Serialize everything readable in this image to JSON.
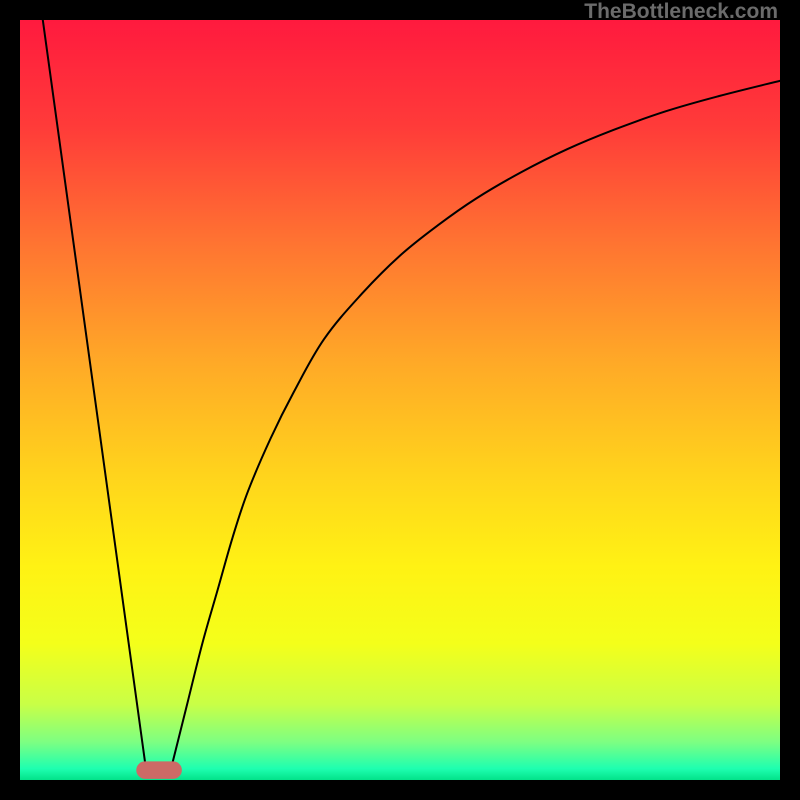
{
  "watermark": "TheBottleneck.com",
  "chart_data": {
    "type": "line",
    "title": "",
    "xlabel": "",
    "ylabel": "",
    "xlim": [
      0,
      100
    ],
    "ylim": [
      0,
      100
    ],
    "grid": false,
    "legend": false,
    "background": {
      "type": "vertical-gradient",
      "stops": [
        {
          "pos": 0.0,
          "color": "#ff1a3e"
        },
        {
          "pos": 0.14,
          "color": "#ff3b39"
        },
        {
          "pos": 0.3,
          "color": "#ff7631"
        },
        {
          "pos": 0.45,
          "color": "#ffa927"
        },
        {
          "pos": 0.6,
          "color": "#ffd41c"
        },
        {
          "pos": 0.72,
          "color": "#fff214"
        },
        {
          "pos": 0.82,
          "color": "#f4ff1a"
        },
        {
          "pos": 0.9,
          "color": "#c9ff46"
        },
        {
          "pos": 0.95,
          "color": "#7dff82"
        },
        {
          "pos": 0.985,
          "color": "#1effb0"
        },
        {
          "pos": 1.0,
          "color": "#02e289"
        }
      ]
    },
    "series": [
      {
        "name": "left-branch",
        "description": "steep descending line from top-left toward minimum",
        "x": [
          3.0,
          16.5
        ],
        "y": [
          100,
          2
        ]
      },
      {
        "name": "right-branch",
        "description": "ascending saturating curve from minimum toward upper-right",
        "x": [
          20.0,
          22,
          24,
          26,
          28,
          30,
          33,
          36,
          40,
          45,
          50,
          55,
          60,
          66,
          72,
          78,
          85,
          92,
          100
        ],
        "y": [
          2,
          10,
          18,
          25,
          32,
          38,
          45,
          51,
          58,
          64,
          69,
          73,
          76.5,
          80,
          83,
          85.5,
          88,
          90,
          92
        ]
      }
    ],
    "marker": {
      "name": "bottom-pill",
      "shape": "rounded-rect",
      "center_x": 18.3,
      "center_y": 1.3,
      "width": 6.0,
      "height": 2.3,
      "color": "#cc6a66"
    }
  }
}
